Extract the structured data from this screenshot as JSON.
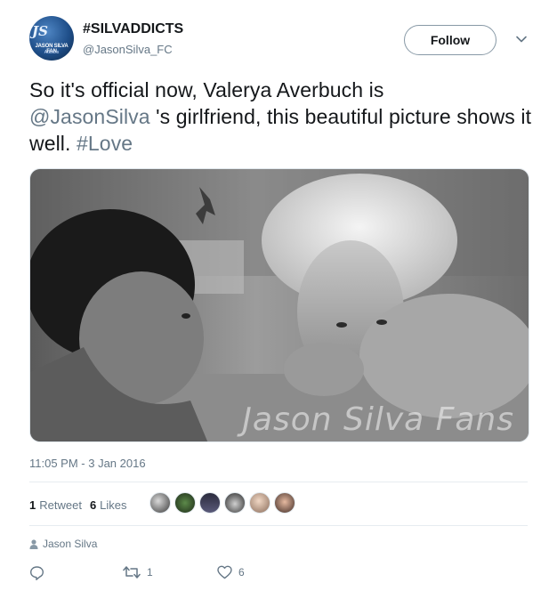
{
  "account": {
    "avatar_text_1": "JS",
    "avatar_text_2": "JASON SILVA FAN",
    "avatar_text_3": "Addicts",
    "name": "#SILVADDICTS",
    "handle": "@JasonSilva_FC"
  },
  "follow_label": "Follow",
  "tweet": {
    "text_1": "So it's official now, Valerya Averbuch is",
    "mention": "@JasonSilva",
    "text_2": " 's girlfriend, this beautiful picture shows it well. ",
    "hashtag": "#Love"
  },
  "photo": {
    "watermark": "Jason Silva Fans"
  },
  "timestamp": "11:05 PM - 3 Jan 2016",
  "stats": {
    "retweets_count": "1",
    "retweets_label": "Retweet",
    "likes_count": "6",
    "likes_label": "Likes"
  },
  "reply_context": "Jason Silva",
  "actions": {
    "retweet_count": "1",
    "like_count": "6"
  },
  "colors": {
    "text": "#14171a",
    "secondary": "#657786",
    "divider": "#e6ecf0"
  },
  "icons": [
    "chevron-down-icon",
    "person-icon",
    "reply-icon",
    "retweet-icon",
    "heart-icon"
  ]
}
